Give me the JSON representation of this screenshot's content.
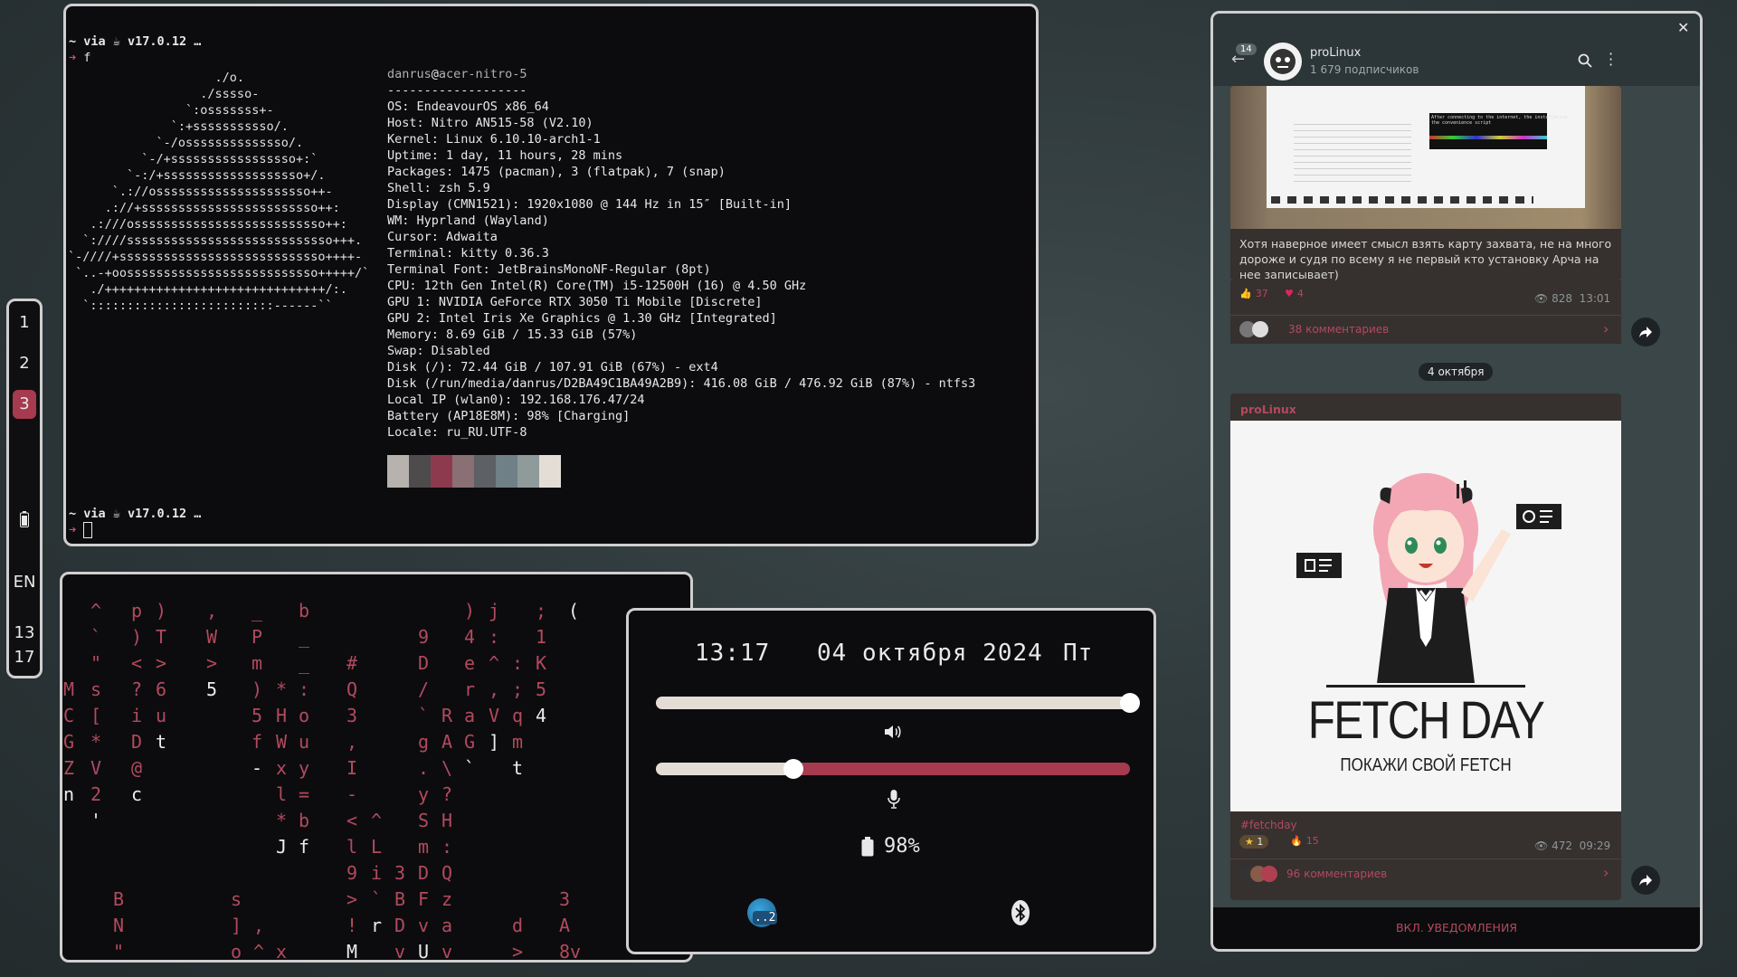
{
  "terminal1": {
    "prompt1_dir": "~",
    "prompt1_suffix": "via ☕ v17.0.12 …",
    "prompt1_arrow": "➜",
    "prompt1_command": "f",
    "ascii_art": [
      "                    ./o.",
      "                  ./sssso-",
      "                `:osssssss+-",
      "              `:+sssssssssso/.",
      "            `-/ossssssssssssso/.",
      "          `-/+sssssssssssssssso+:`",
      "        `-:/+sssssssssssssssssso+/.",
      "      `.://osssssssssssssssssssso++-",
      "     .://+ssssssssssssssssssssssso++:",
      "   .:///ossssssssssssssssssssssssso++:",
      "  `:////ssssssssssssssssssssssssssso+++.",
      "`-////+ssssssssssssssssssssssssssso++++-",
      " `..-+oossssssssssssssssssssssssso+++++/`",
      "   ./++++++++++++++++++++++++++++++/:.",
      "  `:::::::::::::::::::::::::------``"
    ],
    "user": "danrus",
    "at": "@",
    "host": "acer-nitro-5",
    "separator": "-------------------",
    "info": [
      {
        "k": "OS",
        "v": "EndeavourOS x86_64"
      },
      {
        "k": "Host",
        "v": "Nitro AN515-58 (V2.10)"
      },
      {
        "k": "Kernel",
        "v": "Linux 6.10.10-arch1-1"
      },
      {
        "k": "Uptime",
        "v": "1 day, 11 hours, 28 mins"
      },
      {
        "k": "Packages",
        "v": "1475 (pacman), 3 (flatpak), 7 (snap)"
      },
      {
        "k": "Shell",
        "v": "zsh 5.9"
      },
      {
        "k": "Display (CMN1521)",
        "v": "1920x1080 @ 144 Hz in 15″ [Built-in]"
      },
      {
        "k": "WM",
        "v": "Hyprland (Wayland)"
      },
      {
        "k": "Cursor",
        "v": "Adwaita"
      },
      {
        "k": "Terminal",
        "v": "kitty 0.36.3"
      },
      {
        "k": "Terminal Font",
        "v": "JetBrainsMonoNF-Regular (8pt)"
      },
      {
        "k": "CPU",
        "v": "12th Gen Intel(R) Core(TM) i5-12500H (16) @ 4.50 GHz"
      },
      {
        "k": "GPU 1",
        "v": "NVIDIA GeForce RTX 3050 Ti Mobile [Discrete]"
      },
      {
        "k": "GPU 2",
        "v": "Intel Iris Xe Graphics @ 1.30 GHz [Integrated]"
      },
      {
        "k": "Memory",
        "v": "8.69 GiB / 15.33 GiB (57%)"
      },
      {
        "k": "Swap",
        "v": "Disabled"
      },
      {
        "k": "Disk (/)",
        "v": "72.44 GiB / 107.91 GiB (67%) - ext4"
      },
      {
        "k": "Disk (/run/media/danrus/D2BA49C1BA49A2B9)",
        "v": "416.08 GiB / 476.92 GiB (87%) - ntfs3"
      },
      {
        "k": "Local IP (wlan0)",
        "v": "192.168.176.47/24"
      },
      {
        "k": "Battery (AP18E8M)",
        "v": "98% [Charging]"
      },
      {
        "k": "Locale",
        "v": "ru_RU.UTF-8"
      }
    ],
    "palette_colors": [
      "#b7b2ad",
      "#4e4b4c",
      "#8e3a4e",
      "#8a6f74",
      "#5d6064",
      "#6f8086",
      "#8f9a9b",
      "#e4ddd6"
    ],
    "prompt2_dir": "~",
    "prompt2_suffix": "via ☕ v17.0.12 …",
    "prompt2_arrow": "➜"
  },
  "workspaces": {
    "items": [
      "1",
      "2",
      "3"
    ],
    "active": "3",
    "battery_icon": "battery-icon",
    "layout": "EN",
    "time_hour": "13",
    "time_min": "17"
  },
  "matrix_chars": [
    [
      "^",
      100,
      40,
      0
    ],
    [
      "p",
      145,
      40,
      0
    ],
    [
      ")",
      172,
      40,
      0
    ],
    [
      ",",
      228,
      40,
      0
    ],
    [
      "_",
      278,
      40,
      0
    ],
    [
      "b",
      330,
      40,
      0
    ],
    [
      ")",
      513,
      40,
      0
    ],
    [
      "j",
      540,
      40,
      0
    ],
    [
      ";",
      592,
      40,
      0
    ],
    [
      "(",
      628,
      40,
      1
    ],
    [
      "`",
      100,
      69,
      0
    ],
    [
      ")",
      145,
      69,
      0
    ],
    [
      "T",
      172,
      69,
      0
    ],
    [
      "W",
      228,
      69,
      0
    ],
    [
      "P",
      278,
      69,
      0
    ],
    [
      "_",
      330,
      69,
      0
    ],
    [
      "9",
      462,
      69,
      0
    ],
    [
      "4",
      513,
      69,
      0
    ],
    [
      ":",
      540,
      69,
      0
    ],
    [
      "1",
      592,
      69,
      0
    ],
    [
      "\"",
      100,
      98,
      0
    ],
    [
      "<",
      145,
      98,
      0
    ],
    [
      ">",
      172,
      98,
      0
    ],
    [
      ">",
      228,
      98,
      0
    ],
    [
      "m",
      278,
      98,
      0
    ],
    [
      "_",
      330,
      98,
      0
    ],
    [
      "#",
      383,
      98,
      0
    ],
    [
      "D",
      462,
      98,
      0
    ],
    [
      "e",
      513,
      98,
      0
    ],
    [
      "^",
      540,
      98,
      0
    ],
    [
      ":",
      566,
      98,
      0
    ],
    [
      "K",
      592,
      98,
      0
    ],
    [
      "M",
      70,
      127,
      0
    ],
    [
      "s",
      100,
      127,
      0
    ],
    [
      "?",
      145,
      127,
      0
    ],
    [
      "6",
      172,
      127,
      0
    ],
    [
      "5",
      228,
      127,
      1
    ],
    [
      ")",
      278,
      127,
      0
    ],
    [
      "*",
      305,
      127,
      0
    ],
    [
      ":",
      330,
      127,
      0
    ],
    [
      "Q",
      383,
      127,
      0
    ],
    [
      "/",
      462,
      127,
      0
    ],
    [
      "r",
      513,
      127,
      0
    ],
    [
      ",",
      540,
      127,
      0
    ],
    [
      ";",
      566,
      127,
      0
    ],
    [
      "5",
      592,
      127,
      0
    ],
    [
      "C",
      70,
      156,
      0
    ],
    [
      "[",
      100,
      156,
      0
    ],
    [
      "i",
      145,
      156,
      0
    ],
    [
      "u",
      172,
      156,
      0
    ],
    [
      "5",
      278,
      156,
      0
    ],
    [
      "H",
      305,
      156,
      0
    ],
    [
      "o",
      330,
      156,
      0
    ],
    [
      "3",
      383,
      156,
      0
    ],
    [
      "`",
      462,
      156,
      0
    ],
    [
      "R",
      488,
      156,
      0
    ],
    [
      "a",
      513,
      156,
      0
    ],
    [
      "V",
      540,
      156,
      0
    ],
    [
      "q",
      566,
      156,
      0
    ],
    [
      "4",
      592,
      156,
      1
    ],
    [
      "G",
      70,
      185,
      0
    ],
    [
      "*",
      100,
      185,
      0
    ],
    [
      "D",
      145,
      185,
      0
    ],
    [
      "t",
      172,
      185,
      1
    ],
    [
      "f",
      278,
      185,
      0
    ],
    [
      "W",
      305,
      185,
      0
    ],
    [
      "u",
      330,
      185,
      0
    ],
    [
      ",",
      383,
      185,
      0
    ],
    [
      "g",
      462,
      185,
      0
    ],
    [
      "A",
      488,
      185,
      0
    ],
    [
      "G",
      513,
      185,
      0
    ],
    [
      "]",
      540,
      185,
      1
    ],
    [
      "m",
      566,
      185,
      0
    ],
    [
      "Z",
      70,
      214,
      0
    ],
    [
      "V",
      100,
      214,
      0
    ],
    [
      "@",
      145,
      214,
      0
    ],
    [
      "-",
      278,
      214,
      1
    ],
    [
      "x",
      305,
      214,
      0
    ],
    [
      "y",
      330,
      214,
      0
    ],
    [
      "I",
      383,
      214,
      0
    ],
    [
      ".",
      462,
      214,
      0
    ],
    [
      "\\",
      488,
      214,
      0
    ],
    [
      "`",
      513,
      214,
      1
    ],
    [
      "t",
      566,
      214,
      1
    ],
    [
      "n",
      70,
      243,
      1
    ],
    [
      "2",
      100,
      243,
      0
    ],
    [
      "c",
      145,
      243,
      1
    ],
    [
      "l",
      305,
      243,
      0
    ],
    [
      "=",
      330,
      243,
      0
    ],
    [
      "-",
      383,
      243,
      0
    ],
    [
      "y",
      462,
      243,
      0
    ],
    [
      "?",
      488,
      243,
      0
    ],
    [
      "'",
      100,
      272,
      1
    ],
    [
      "*",
      305,
      272,
      0
    ],
    [
      "b",
      330,
      272,
      0
    ],
    [
      "<",
      383,
      272,
      0
    ],
    [
      "^",
      410,
      272,
      0
    ],
    [
      "S",
      462,
      272,
      0
    ],
    [
      "H",
      488,
      272,
      0
    ],
    [
      "J",
      305,
      301,
      1
    ],
    [
      "f",
      330,
      301,
      1
    ],
    [
      "l",
      383,
      301,
      0
    ],
    [
      "L",
      410,
      301,
      0
    ],
    [
      "m",
      462,
      301,
      0
    ],
    [
      ":",
      488,
      301,
      0
    ],
    [
      "9",
      383,
      330,
      0
    ],
    [
      "i",
      410,
      330,
      0
    ],
    [
      "3",
      436,
      330,
      0
    ],
    [
      "D",
      462,
      330,
      0
    ],
    [
      "Q",
      488,
      330,
      0
    ],
    [
      "B",
      125,
      359,
      0
    ],
    [
      "s",
      255,
      359,
      0
    ],
    [
      ">",
      383,
      359,
      0
    ],
    [
      "`",
      410,
      359,
      0
    ],
    [
      "B",
      436,
      359,
      0
    ],
    [
      "F",
      462,
      359,
      0
    ],
    [
      "z",
      488,
      359,
      0
    ],
    [
      "3",
      618,
      359,
      0
    ],
    [
      "N",
      125,
      388,
      0
    ],
    [
      "]",
      255,
      388,
      0
    ],
    [
      ",",
      280,
      388,
      0
    ],
    [
      "!",
      383,
      388,
      0
    ],
    [
      "r",
      410,
      388,
      1
    ],
    [
      "D",
      436,
      388,
      0
    ],
    [
      "v",
      462,
      388,
      0
    ],
    [
      "a",
      488,
      388,
      0
    ],
    [
      "d",
      566,
      388,
      0
    ],
    [
      "A",
      618,
      388,
      0
    ],
    [
      "\"",
      125,
      417,
      0
    ],
    [
      "o",
      255,
      417,
      0
    ],
    [
      "^",
      280,
      417,
      0
    ],
    [
      "x",
      305,
      417,
      0
    ],
    [
      "M",
      383,
      417,
      1
    ],
    [
      "v",
      436,
      417,
      0
    ],
    [
      "U",
      462,
      417,
      1
    ],
    [
      "v",
      488,
      417,
      0
    ],
    [
      ">",
      566,
      417,
      0
    ],
    [
      "8v",
      618,
      417,
      0
    ]
  ],
  "control": {
    "time": "13:17",
    "date": "04 октября 2024",
    "weekday": "Пт",
    "volume_level": 1.0,
    "mic_level": 0.29,
    "volume_icon": "speaker-icon",
    "mic_icon": "microphone-icon",
    "battery_text": "98%",
    "battery_icon": "battery-icon",
    "tray_badge": "..2",
    "bluetooth_icon": "bluetooth-icon"
  },
  "telegram": {
    "unread_badge": "14",
    "channel_name": "proLinux",
    "subscribers": "1 679 подписчиков",
    "post1": {
      "text": "Хотя наверное имеет смысл взять карту захвата, не на много дороже и судя по всему я не первый кто установку Арча на нее записывает)",
      "reaction1_count": "37",
      "reaction2_count": "4",
      "views": "828",
      "time": "13:01",
      "comments": "38 комментариев",
      "screen_text": "After connecting to the internet, the installation\nthe convenience script "
    },
    "date_separator": "4 октября",
    "post2": {
      "author": "proLinux",
      "image_title": "FETCH DAY",
      "image_subtitle": "ПОКАЖИ СВОЙ FETCH",
      "hashtag": "#fetchday",
      "reaction1_count": "1",
      "reaction2_count": "15",
      "views": "472",
      "time": "09:29",
      "comments": "96 комментариев"
    },
    "footer": "ВКЛ. УВЕДОМЛЕНИЯ",
    "accent": "#b24a5e"
  }
}
